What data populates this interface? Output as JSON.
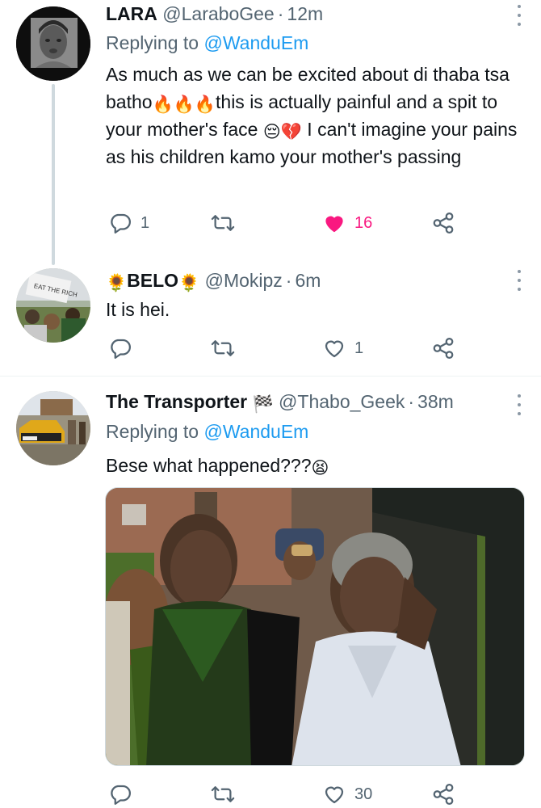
{
  "tweets": [
    {
      "name": "LARA",
      "handle": "@LaraboGee",
      "time": "12m",
      "replying_prefix": "Replying to",
      "replying_to": "@WanduEm",
      "text_part1": "As much as we can be excited about di thaba tsa batho",
      "text_emojis1": "🔥🔥🔥",
      "text_part2": "this is actually painful and a spit to your mother's face",
      "text_emojis2": "😔💔",
      "text_part3": " I can't imagine your pains as his children kamo your mother's passing",
      "replies": "1",
      "retweets": "",
      "likes": "16",
      "liked": true
    },
    {
      "name": "BELO",
      "name_emoji": "🌻",
      "handle": "@Mokipz",
      "time": "6m",
      "text": "It is hei.",
      "replies": "",
      "retweets": "",
      "likes": "1"
    },
    {
      "name": "The Transporter",
      "name_emoji": "🏁",
      "handle": "@Thabo_Geek",
      "time": "38m",
      "replying_prefix": "Replying to",
      "replying_to": "@WanduEm",
      "text": "Bese what happened???",
      "text_emoji": "😫",
      "replies": "",
      "retweets": "",
      "likes": "30"
    }
  ],
  "icons": {
    "reply": "reply-icon",
    "retweet": "retweet-icon",
    "like": "heart-icon",
    "share": "share-icon",
    "more": "more-options-icon"
  },
  "colors": {
    "accent": "#1d9bf0",
    "like": "#f91880",
    "muted": "#536471"
  }
}
